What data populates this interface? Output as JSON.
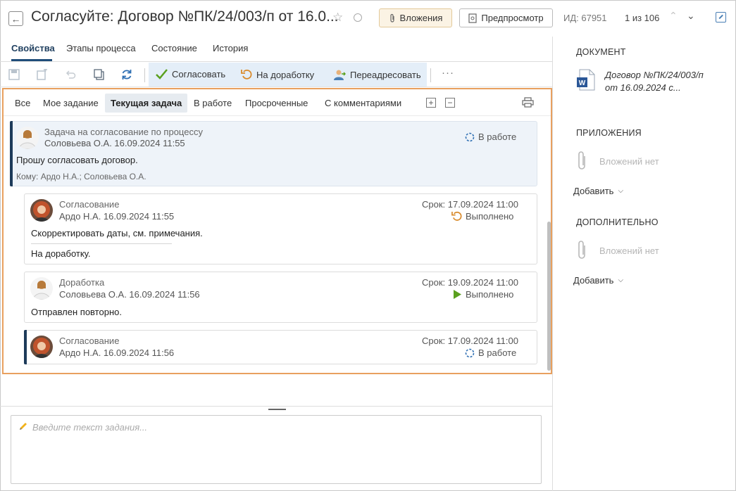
{
  "header": {
    "title": "Согласуйте: Договор №ПК/24/003/п от 16.0...",
    "attachments_label": "Вложения",
    "preview_label": "Предпросмотр",
    "id_label": "ИД: 67951",
    "pager": "1 из 106"
  },
  "tabs": [
    "Свойства",
    "Этапы процесса",
    "Состояние",
    "История"
  ],
  "toolbar": {
    "approve": "Согласовать",
    "rework": "На доработку",
    "redirect": "Переадресовать",
    "more": "···"
  },
  "filters": [
    "Все",
    "Мое задание",
    "Текущая задача",
    "В работе",
    "Просроченные",
    "С комментариями"
  ],
  "feed": {
    "main": {
      "type": "Задача на согласование по процессу",
      "author": "Соловьева О.А.  16.09.2024 11:55",
      "status": "В работе",
      "text": "Прошу согласовать договор.",
      "to": "Кому: Ардо Н.А.; Соловьева О.А."
    },
    "items": [
      {
        "type": "Согласование",
        "author": "Ардо Н.А.  16.09.2024 11:55",
        "due": "Срок: 17.09.2024 11:00",
        "status": "Выполнено",
        "text1": "Скорректировать даты, см. примечания.",
        "text2": "На доработку."
      },
      {
        "type": "Доработка",
        "author": "Соловьева О.А.  16.09.2024 11:56",
        "due": "Срок: 19.09.2024 11:00",
        "status": "Выполнено",
        "text1": "Отправлен повторно."
      },
      {
        "type": "Согласование",
        "author": "Ардо Н.А.  16.09.2024 11:56",
        "due": "Срок: 17.09.2024 11:00",
        "status": "В работе"
      }
    ]
  },
  "composer": {
    "placeholder": "Введите текст задания..."
  },
  "right": {
    "document_heading": "ДОКУМЕНТ",
    "document_name": "Договор №ПК/24/003/п от 16.09.2024 с...",
    "attachments_heading": "ПРИЛОЖЕНИЯ",
    "attachments_empty": "Вложений нет",
    "attachments_add": "Добавить",
    "extra_heading": "ДОПОЛНИТЕЛЬНО",
    "extra_empty": "Вложений нет",
    "extra_add": "Добавить"
  },
  "colors": {
    "accent": "#1f4d7a",
    "highlight_border": "#e8a05f",
    "done_green": "#5aa01e",
    "rework_orange": "#d98a2b"
  }
}
